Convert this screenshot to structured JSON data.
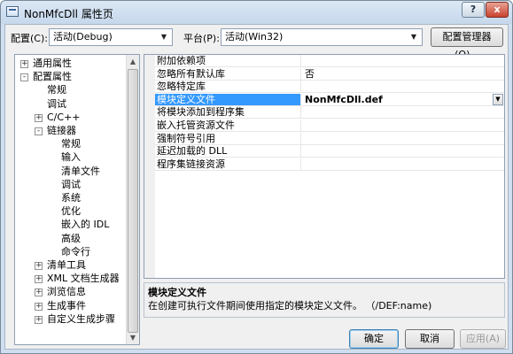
{
  "window": {
    "title": "NonMfcDll 属性页",
    "help": "?",
    "close": "x"
  },
  "config": {
    "label": "配置(C):",
    "value": "活动(Debug)"
  },
  "platform": {
    "label": "平台(P):",
    "value": "活动(Win32)"
  },
  "config_manager_button": "配置管理器(O)...",
  "tree": [
    {
      "label": "通用属性",
      "level": 0,
      "toggle": "+"
    },
    {
      "label": "配置属性",
      "level": 0,
      "toggle": "-"
    },
    {
      "label": "常规",
      "level": 1,
      "toggle": ""
    },
    {
      "label": "调试",
      "level": 1,
      "toggle": ""
    },
    {
      "label": "C/C++",
      "level": 1,
      "toggle": "+"
    },
    {
      "label": "链接器",
      "level": 1,
      "toggle": "-"
    },
    {
      "label": "常规",
      "level": 2,
      "toggle": ""
    },
    {
      "label": "输入",
      "level": 2,
      "toggle": ""
    },
    {
      "label": "清单文件",
      "level": 2,
      "toggle": ""
    },
    {
      "label": "调试",
      "level": 2,
      "toggle": ""
    },
    {
      "label": "系统",
      "level": 2,
      "toggle": ""
    },
    {
      "label": "优化",
      "level": 2,
      "toggle": ""
    },
    {
      "label": "嵌入的 IDL",
      "level": 2,
      "toggle": ""
    },
    {
      "label": "高级",
      "level": 2,
      "toggle": ""
    },
    {
      "label": "命令行",
      "level": 2,
      "toggle": ""
    },
    {
      "label": "清单工具",
      "level": 1,
      "toggle": "+"
    },
    {
      "label": "XML 文档生成器",
      "level": 1,
      "toggle": "+"
    },
    {
      "label": "浏览信息",
      "level": 1,
      "toggle": "+"
    },
    {
      "label": "生成事件",
      "level": 1,
      "toggle": "+"
    },
    {
      "label": "自定义生成步骤",
      "level": 1,
      "toggle": "+"
    }
  ],
  "properties": [
    {
      "name": "附加依赖项",
      "value": ""
    },
    {
      "name": "忽略所有默认库",
      "value": "否"
    },
    {
      "name": "忽略特定库",
      "value": ""
    },
    {
      "name": "模块定义文件",
      "value": "NonMfcDll.def",
      "selected": true
    },
    {
      "name": "将模块添加到程序集",
      "value": ""
    },
    {
      "name": "嵌入托管资源文件",
      "value": ""
    },
    {
      "name": "强制符号引用",
      "value": ""
    },
    {
      "name": "延迟加载的 DLL",
      "value": ""
    },
    {
      "name": "程序集链接资源",
      "value": ""
    }
  ],
  "description": {
    "title": "模块定义文件",
    "text": "在创建可执行文件期间使用指定的模块定义文件。  （/DEF:name)"
  },
  "buttons": {
    "ok": "确定",
    "cancel": "取消",
    "apply": "应用(A)"
  }
}
